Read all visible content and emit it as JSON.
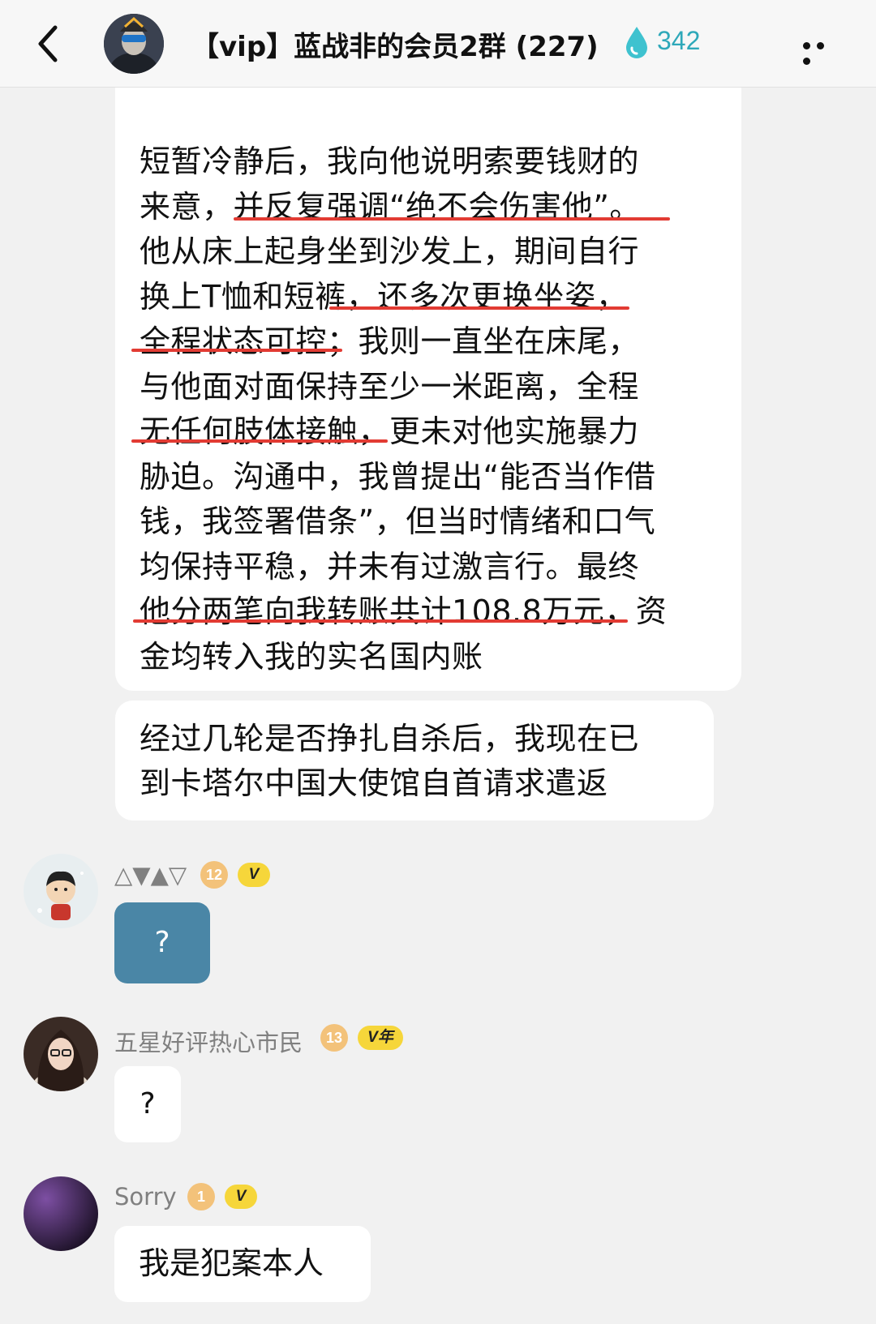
{
  "header": {
    "back_icon": "chevron-left-icon",
    "title": "【vip】蓝战非的会员2群 (227)",
    "drop_icon": "water-drop-icon",
    "score": "342",
    "more_icon": "more-dots-icon",
    "score_color": "#2ea8b9"
  },
  "messages": [
    {
      "lines": [
        "短暂冷静后，我向他说明索要钱财的",
        "来意，并反复强调“绝不会伤害他”。",
        "他从床上起身坐到沙发上，期间自行",
        "换上T恤和短裤，还多次更换坐姿，",
        "全程状态可控；我则一直坐在床尾，",
        "与他面对面保持至少一米距离，全程",
        "无任何肢体接触，更未对他实施暴力",
        "胁迫。沟通中，我曾提出“能否当作借",
        "钱，我签署借条”，但当时情绪和口气",
        "均保持平稳，并未有过激言行。最终",
        "他分两笔向我转账共计108.8万元，资",
        "金均转入我的实名国内账"
      ],
      "underline_color": "#e23b33"
    },
    {
      "lines": [
        "经过几轮是否挣扎自杀后，我现在已",
        "到卡塔尔中国大使馆自首请求遣返"
      ]
    },
    {
      "user": "△▼▲▽",
      "level": "12",
      "badge": "V",
      "text": "?",
      "bubble_color": "#4a86a6"
    },
    {
      "user": "五星好评热心市民",
      "level": "13",
      "badge": "V年",
      "text": "?"
    },
    {
      "user": "Sorry",
      "level": "1",
      "badge": "V",
      "text": "我是犯案本人"
    }
  ]
}
